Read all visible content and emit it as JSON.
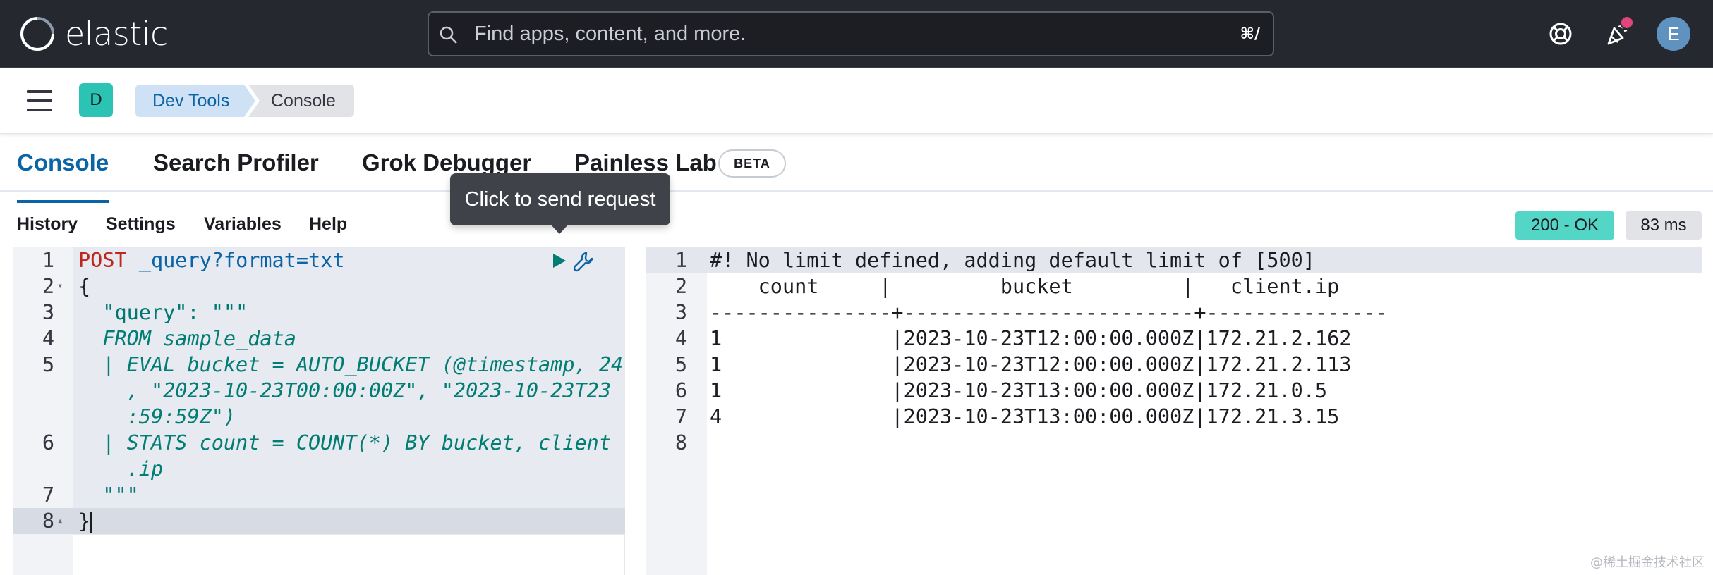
{
  "header": {
    "logo_text": "elastic",
    "search_placeholder": "Find apps, content, and more.",
    "search_shortcut": "⌘/",
    "avatar_initial": "E",
    "notification_dot_color": "#e0467c"
  },
  "subheader": {
    "space_initial": "D",
    "breadcrumbs": [
      "Dev Tools",
      "Console"
    ]
  },
  "tabs": [
    {
      "label": "Console",
      "active": true
    },
    {
      "label": "Search Profiler",
      "active": false
    },
    {
      "label": "Grok Debugger",
      "active": false
    },
    {
      "label": "Painless Lab",
      "active": false
    }
  ],
  "beta_badge": "BETA",
  "console_menu": [
    "History",
    "Settings",
    "Variables",
    "Help"
  ],
  "tooltip": "Click to send request",
  "status": {
    "code_text": "200 - OK",
    "time_text": "83 ms",
    "status_color": "#54d6c7"
  },
  "request": {
    "line_numbers": [
      "1",
      "2",
      "3",
      "4",
      "5",
      "",
      "",
      "6",
      "",
      "7",
      "8"
    ],
    "method": "POST",
    "url": "_query?format=txt",
    "lines": [
      "{",
      "  \"query\": \"\"\"",
      "  FROM sample_data",
      "  | EVAL bucket = AUTO_BUCKET (@timestamp, 24",
      "    , \"2023-10-23T00:00:00Z\", \"2023-10-23T23",
      "    :59:59Z\")",
      "  | STATS count = COUNT(*) BY bucket, client",
      "    .ip",
      "  \"\"\"",
      "}"
    ]
  },
  "response": {
    "line_numbers": [
      "1",
      "2",
      "3",
      "4",
      "5",
      "6",
      "7",
      "8"
    ],
    "lines": [
      "#! No limit defined, adding default limit of [500]",
      "    count     |         bucket         |   client.ip",
      "---------------+------------------------+---------------",
      "1              |2023-10-23T12:00:00.000Z|172.21.2.162",
      "1              |2023-10-23T12:00:00.000Z|172.21.2.113",
      "1              |2023-10-23T13:00:00.000Z|172.21.0.5",
      "4              |2023-10-23T13:00:00.000Z|172.21.3.15",
      ""
    ]
  },
  "watermark": "@稀土掘金技术社区"
}
